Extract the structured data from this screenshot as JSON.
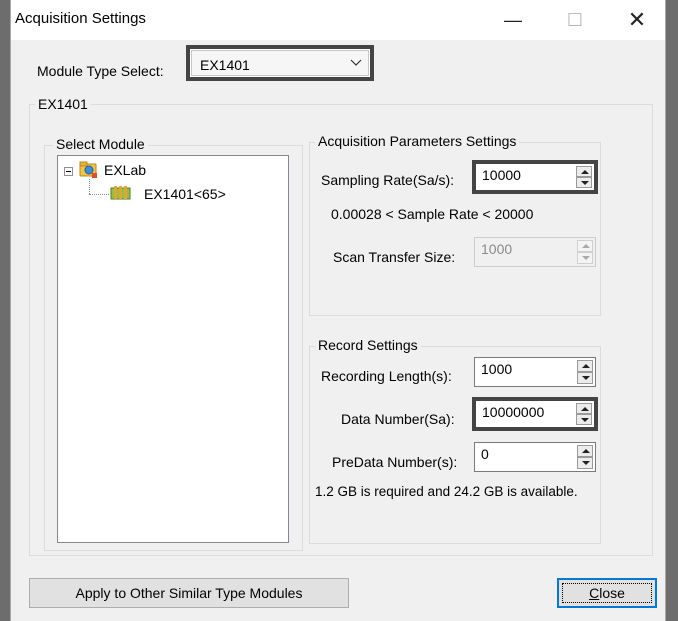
{
  "window": {
    "title": "Acquisition Settings",
    "minimize_symbol": "—",
    "maximize_symbol": "☐",
    "close_symbol": "✕"
  },
  "module_type": {
    "label": "Module Type Select:",
    "value": "EX1401"
  },
  "module_group": {
    "title": "EX1401"
  },
  "select_module": {
    "title": "Select Module",
    "tree": {
      "root": {
        "label": "EXLab",
        "icon": "network-folder-icon"
      },
      "child": {
        "label": "EX1401<65>",
        "icon": "module-device-icon"
      }
    }
  },
  "acquisition_params": {
    "title": "Acquisition Parameters Settings",
    "sampling_rate": {
      "label": "Sampling Rate(Sa/s):",
      "value": "10000"
    },
    "rate_range": "0.00028 < Sample Rate < 20000",
    "scan_transfer": {
      "label": "Scan Transfer Size:",
      "value": "1000"
    }
  },
  "record_settings": {
    "title": "Record Settings",
    "recording_length": {
      "label": "Recording Length(s):",
      "value": "1000"
    },
    "data_number": {
      "label": "Data Number(Sa):",
      "value": "10000000"
    },
    "predata_number": {
      "label": "PreData Number(s):",
      "value": "0"
    },
    "storage_info": "1.2 GB is required and 24.2 GB is available."
  },
  "buttons": {
    "apply": "Apply to Other Similar Type Modules",
    "close_first": "C",
    "close_rest": "lose"
  },
  "colors": {
    "highlight_border": "#444444",
    "focus_blue": "#0078d7",
    "dialog_bg": "#f0f0f0"
  }
}
